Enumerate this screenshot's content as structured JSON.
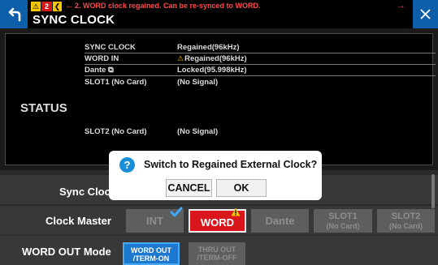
{
  "header": {
    "title": "SYNC CLOCK",
    "warning_badge": "⚠",
    "count_badge": "2",
    "prev_badge": "❮",
    "left_arrow": "←",
    "message": "2. WORD clock regained. Can be re-synced to WORD.",
    "right_arrow": "→"
  },
  "status": {
    "label": "STATUS",
    "rows": [
      {
        "key": "SYNC CLOCK",
        "value": "Regained(96kHz)"
      },
      {
        "key": "WORD IN",
        "warn": "⚠",
        "value": "Regained(96kHz)"
      },
      {
        "key": "Dante ⧉",
        "value": "Locked(95.998kHz)"
      },
      {
        "key": "SLOT1 (No Card)",
        "value": "(No Signal)"
      },
      {
        "key": "SLOT2 (No Card)",
        "value": "(No Signal)"
      }
    ]
  },
  "sync_clock": {
    "label": "Sync Cloc"
  },
  "clock_master": {
    "label": "Clock Master",
    "options": [
      {
        "label": "INT"
      },
      {
        "label": "WORD"
      },
      {
        "label": "Dante"
      },
      {
        "label": "SLOT1",
        "sub": "(No Card)"
      },
      {
        "label": "SLOT2",
        "sub": "(No Card)"
      }
    ]
  },
  "word_out": {
    "label": "WORD OUT Mode",
    "options": [
      {
        "line1": "WORD OUT",
        "line2": "/TERM-ON"
      },
      {
        "line1": "THRU OUT",
        "line2": "/TERM-OFF"
      }
    ]
  },
  "dialog": {
    "icon": "?",
    "message": "Switch to Regained External Clock?",
    "cancel": "CANCEL",
    "ok": "OK"
  },
  "colors": {
    "accent_blue": "#0c5fa8",
    "selected_red": "#d9161b",
    "word_out_blue": "#1d78d0",
    "warning_yellow": "#f2c500",
    "message_red": "#ff4a4a"
  }
}
